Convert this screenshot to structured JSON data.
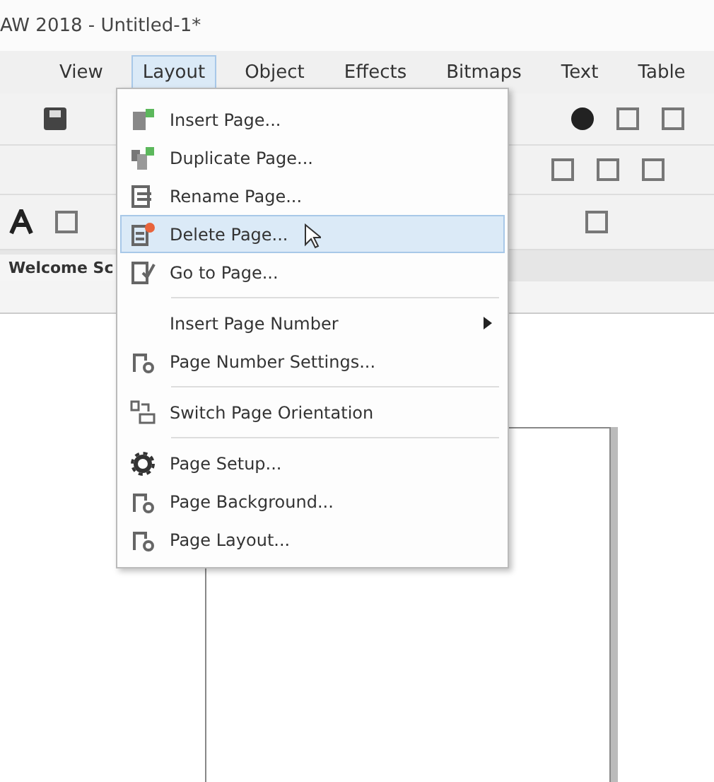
{
  "window": {
    "title": "AW 2018 - Untitled-1*"
  },
  "menu_bar": [
    {
      "label": "View",
      "selected": false
    },
    {
      "label": "Layout",
      "selected": true
    },
    {
      "label": "Object",
      "selected": false
    },
    {
      "label": "Effects",
      "selected": false
    },
    {
      "label": "Bitmaps",
      "selected": false
    },
    {
      "label": "Text",
      "selected": false
    },
    {
      "label": "Table",
      "selected": false
    }
  ],
  "document_tab": {
    "label": "Welcome Sc"
  },
  "layout_menu": {
    "sections": [
      {
        "items": [
          {
            "label": "Insert Page...",
            "selected": false,
            "submenu": false
          },
          {
            "label": "Duplicate Page...",
            "selected": false,
            "submenu": false
          },
          {
            "label": "Rename Page...",
            "selected": false,
            "submenu": false
          },
          {
            "label": "Delete Page...",
            "selected": true,
            "submenu": false
          },
          {
            "label": "Go to Page...",
            "selected": false,
            "submenu": false
          }
        ]
      },
      {
        "items": [
          {
            "label": "Insert Page Number",
            "selected": false,
            "submenu": true
          },
          {
            "label": "Page Number Settings...",
            "selected": false,
            "submenu": false
          }
        ]
      },
      {
        "items": [
          {
            "label": "Switch Page Orientation",
            "selected": false,
            "submenu": false
          }
        ]
      },
      {
        "items": [
          {
            "label": "Page Setup...",
            "selected": false,
            "submenu": false
          },
          {
            "label": "Page Background...",
            "selected": false,
            "submenu": false
          },
          {
            "label": "Page Layout...",
            "selected": false,
            "submenu": false
          }
        ]
      }
    ]
  }
}
